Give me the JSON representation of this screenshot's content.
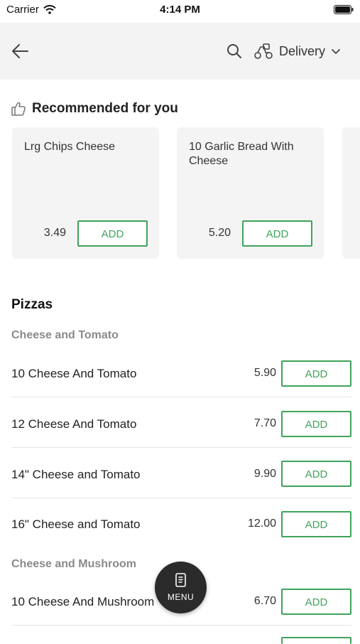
{
  "status_bar": {
    "carrier": "Carrier",
    "time": "4:14 PM"
  },
  "header": {
    "delivery_label": "Delivery"
  },
  "recommended": {
    "title": "Recommended for you",
    "cards": [
      {
        "name": "Lrg Chips Cheese",
        "price": "3.49",
        "add_label": "ADD"
      },
      {
        "name": "10 Garlic Bread With Cheese",
        "price": "5.20",
        "add_label": "ADD"
      }
    ]
  },
  "menu": {
    "section_title": "Pizzas",
    "categories": [
      {
        "title": "Cheese and Tomato",
        "items": [
          {
            "name": "10 Cheese And Tomato",
            "price": "5.90",
            "add_label": "ADD"
          },
          {
            "name": "12 Cheese And Tomato",
            "price": "7.70",
            "add_label": "ADD"
          },
          {
            "name": "14\" Cheese and Tomato",
            "price": "9.90",
            "add_label": "ADD"
          },
          {
            "name": "16\" Cheese and Tomato",
            "price": "12.00",
            "add_label": "ADD"
          }
        ]
      },
      {
        "title": "Cheese and Mushroom",
        "items": [
          {
            "name": "10 Cheese And Mushroom",
            "price": "6.70",
            "add_label": "ADD"
          }
        ]
      }
    ]
  },
  "menu_button": {
    "label": "MENU"
  },
  "colors": {
    "accent": "#3fa35b",
    "header_bg": "#f3f3f3",
    "card_bg": "#f4f4f4",
    "fab_bg": "#2b2b2b"
  }
}
